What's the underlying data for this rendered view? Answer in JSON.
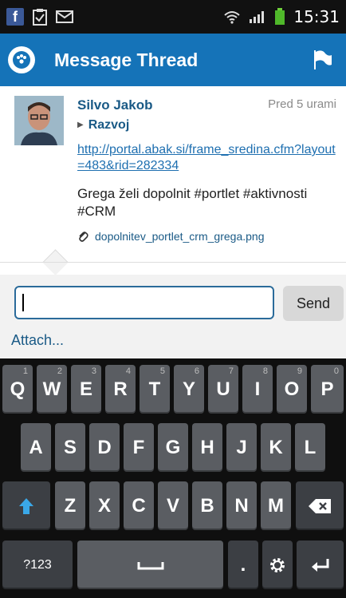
{
  "status_bar": {
    "time": "15:31",
    "icons": [
      "facebook-icon",
      "clipboard-check-icon",
      "mail-icon",
      "wifi-icon",
      "signal-icon",
      "battery-icon"
    ]
  },
  "app_bar": {
    "title": "Message Thread",
    "left_icon": "liferay-logo-icon",
    "right_icon": "flag-icon"
  },
  "post": {
    "author": "Silvo Jakob",
    "time": "Pred 5 urami",
    "group": "Razvoj",
    "link": "http://portal.abak.si/frame_sredina.cfm?layout=483&rid=282334",
    "message": "Grega želi dopolnit #portlet #aktivnosti #CRM",
    "attachment": "dopolnitev_portlet_crm_grega.png"
  },
  "compose": {
    "input_value": "",
    "send_label": "Send",
    "attach_label": "Attach..."
  },
  "keyboard": {
    "row1": [
      {
        "label": "Q",
        "num": "1"
      },
      {
        "label": "W",
        "num": "2"
      },
      {
        "label": "E",
        "num": "3"
      },
      {
        "label": "R",
        "num": "4"
      },
      {
        "label": "T",
        "num": "5"
      },
      {
        "label": "Y",
        "num": "6"
      },
      {
        "label": "U",
        "num": "7"
      },
      {
        "label": "I",
        "num": "8"
      },
      {
        "label": "O",
        "num": "9"
      },
      {
        "label": "P",
        "num": "0"
      }
    ],
    "row2": [
      "A",
      "S",
      "D",
      "F",
      "G",
      "H",
      "J",
      "K",
      "L"
    ],
    "row3": [
      "Z",
      "X",
      "C",
      "V",
      "B",
      "N",
      "M"
    ],
    "symbols_label": "?123",
    "period_label": ".",
    "shift_icon": "shift-arrow-icon",
    "backspace_icon": "backspace-icon",
    "space_icon": "space-icon",
    "settings_icon": "settings-gear-icon",
    "enter_icon": "enter-return-icon"
  },
  "colors": {
    "accent": "#1573b8",
    "link": "#1e6fb0",
    "name": "#1a5a86",
    "key": "#5a5d62",
    "keyboard_bg": "#0f0f0f"
  }
}
